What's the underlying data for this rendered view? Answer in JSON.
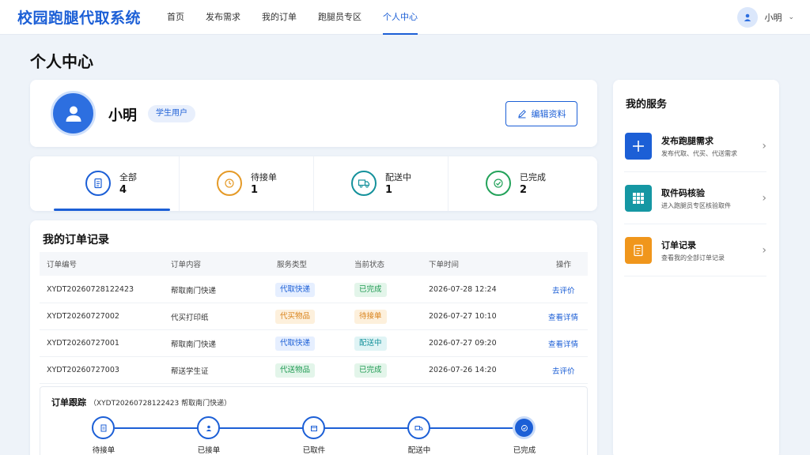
{
  "header": {
    "brand": "校园跑腿代取系统",
    "nav": [
      "首页",
      "发布需求",
      "我的订单",
      "跑腿员专区",
      "个人中心"
    ],
    "active_nav": 4,
    "user_name": "小明"
  },
  "page": {
    "title": "个人中心"
  },
  "profile": {
    "name": "小明",
    "role": "学生用户",
    "edit_label": "编辑资料"
  },
  "stats": [
    {
      "label": "全部",
      "count": "4",
      "color": "#1c5fd6",
      "icon": "document-icon"
    },
    {
      "label": "待接单",
      "count": "1",
      "color": "#e59a27",
      "icon": "clock-icon"
    },
    {
      "label": "配送中",
      "count": "1",
      "color": "#14919b",
      "icon": "truck-icon"
    },
    {
      "label": "已完成",
      "count": "2",
      "color": "#23a25a",
      "icon": "check-circle-icon"
    }
  ],
  "orders": {
    "title": "我的订单记录",
    "headers": [
      "订单编号",
      "订单内容",
      "服务类型",
      "当前状态",
      "下单时间",
      "操作"
    ],
    "rows": [
      {
        "id": "XYDT20260728122423",
        "content": "帮取南门快递",
        "type": "代取快递",
        "status": "已完成",
        "time": "2026-07-28 12:24",
        "action": "去评价"
      },
      {
        "id": "XYDT20260727002",
        "content": "代买打印纸",
        "type": "代买物品",
        "status": "待接单",
        "time": "2026-07-27 10:10",
        "action": "查看详情"
      },
      {
        "id": "XYDT20260727001",
        "content": "帮取南门快递",
        "type": "代取快递",
        "status": "配送中",
        "time": "2026-07-27 09:20",
        "action": "查看详情"
      },
      {
        "id": "XYDT20260727003",
        "content": "帮送学生证",
        "type": "代送物品",
        "status": "已完成",
        "time": "2026-07-26 14:20",
        "action": "去评价"
      }
    ]
  },
  "tracking": {
    "title": "订单跟踪",
    "subtitle": "（XYDT20260728122423 帮取南门快递）",
    "steps": [
      "待接单",
      "已接单",
      "已取件",
      "配送中",
      "已完成"
    ]
  },
  "services": {
    "title": "我的服务",
    "items": [
      {
        "name": "发布跑腿需求",
        "desc": "发布代取、代买、代送需求",
        "color": "#1c5fd6",
        "icon": "plus-icon"
      },
      {
        "name": "取件码核验",
        "desc": "进入跑腿员专区核验取件",
        "color": "#1597a3",
        "icon": "grid-icon"
      },
      {
        "name": "订单记录",
        "desc": "查看我的全部订单记录",
        "color": "#f0961c",
        "icon": "list-icon"
      }
    ]
  }
}
